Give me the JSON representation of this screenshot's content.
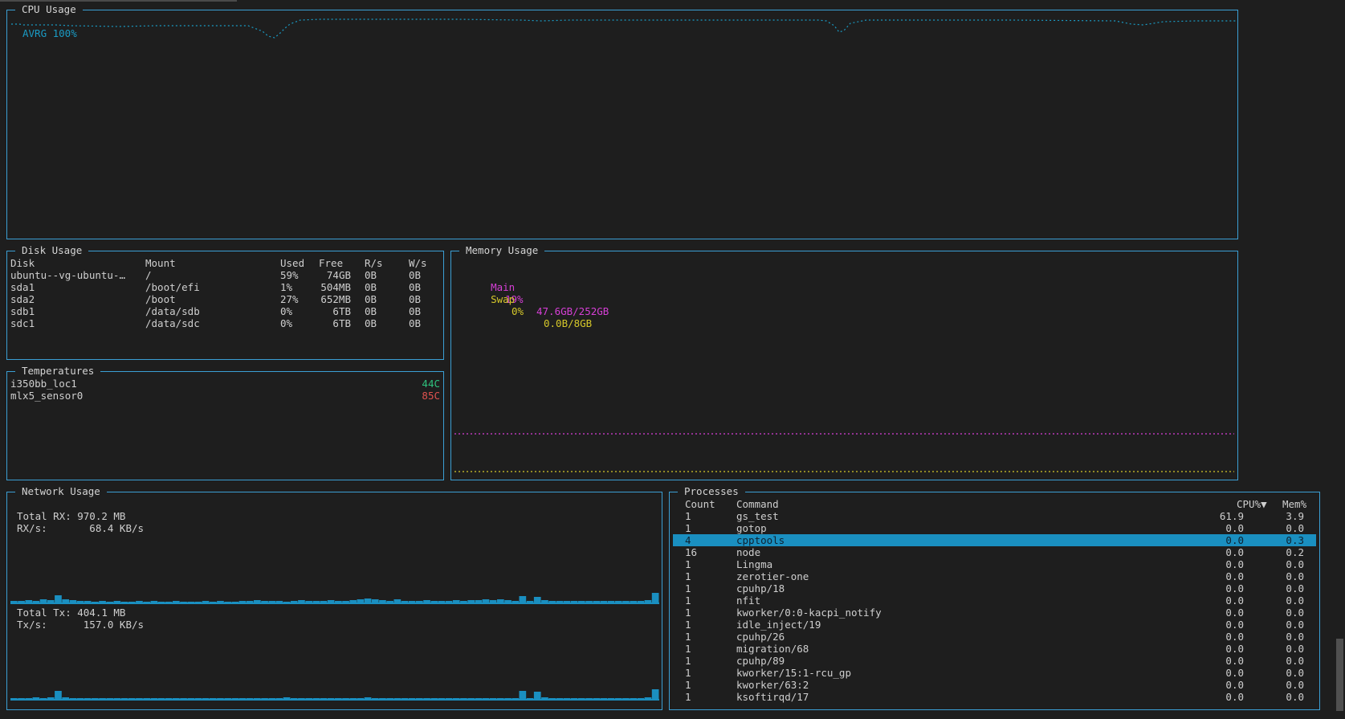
{
  "cpu": {
    "title": "CPU Usage",
    "avg_label": "AVRG 100%",
    "color": "#1a9bc4"
  },
  "disk": {
    "title": "Disk Usage",
    "headers": {
      "disk": "Disk",
      "mount": "Mount",
      "used": "Used",
      "free": "Free",
      "rs": "R/s",
      "ws": "W/s"
    },
    "rows": [
      {
        "disk": "ubuntu--vg-ubuntu-…",
        "mount": "/",
        "used": "59%",
        "free": "74GB",
        "rs": "0B",
        "ws": "0B"
      },
      {
        "disk": "sda1",
        "mount": "/boot/efi",
        "used": "1%",
        "free": "504MB",
        "rs": "0B",
        "ws": "0B"
      },
      {
        "disk": "sda2",
        "mount": "/boot",
        "used": "27%",
        "free": "652MB",
        "rs": "0B",
        "ws": "0B"
      },
      {
        "disk": "sdb1",
        "mount": "/data/sdb",
        "used": "0%",
        "free": "6TB",
        "rs": "0B",
        "ws": "0B"
      },
      {
        "disk": "sdc1",
        "mount": "/data/sdc",
        "used": "0%",
        "free": "6TB",
        "rs": "0B",
        "ws": "0B"
      }
    ]
  },
  "memory": {
    "title": "Memory Usage",
    "main": {
      "label": "Main",
      "percent": "19%",
      "value": "47.6GB/252GB",
      "color": "#d63fd6"
    },
    "swap": {
      "label": "Swap",
      "percent": "0%",
      "value": "0.0B/8GB",
      "color": "#d6c82a"
    }
  },
  "temps": {
    "title": "Temperatures",
    "rows": [
      {
        "name": "i350bb_loc1",
        "value": "44C",
        "color": "#2ec27e"
      },
      {
        "name": "mlx5_sensor0",
        "value": "85C",
        "color": "#e0524f"
      }
    ]
  },
  "network": {
    "title": "Network Usage",
    "rx_total": "Total RX: 970.2 MB",
    "rx_rate": "RX/s:       68.4 KB/s",
    "tx_total": "Total Tx: 404.1 MB",
    "tx_rate": "Tx/s:      157.0 KB/s",
    "bar_color": "#1a8fc0"
  },
  "processes": {
    "title": "Processes",
    "headers": {
      "count": "Count",
      "command": "Command",
      "cpu": "CPU%▼",
      "mem": "Mem%"
    },
    "rows": [
      {
        "count": "1",
        "command": "gs_test",
        "cpu": "61.9",
        "mem": "3.9"
      },
      {
        "count": "1",
        "command": "gotop",
        "cpu": "0.0",
        "mem": "0.0"
      },
      {
        "count": "4",
        "command": "cpptools",
        "cpu": "0.0",
        "mem": "0.3",
        "selected": true
      },
      {
        "count": "16",
        "command": "node",
        "cpu": "0.0",
        "mem": "0.2"
      },
      {
        "count": "1",
        "command": "Lingma",
        "cpu": "0.0",
        "mem": "0.0"
      },
      {
        "count": "1",
        "command": "zerotier-one",
        "cpu": "0.0",
        "mem": "0.0"
      },
      {
        "count": "1",
        "command": "cpuhp/18",
        "cpu": "0.0",
        "mem": "0.0"
      },
      {
        "count": "1",
        "command": "nfit",
        "cpu": "0.0",
        "mem": "0.0"
      },
      {
        "count": "1",
        "command": "kworker/0:0-kacpi_notify",
        "cpu": "0.0",
        "mem": "0.0"
      },
      {
        "count": "1",
        "command": "idle_inject/19",
        "cpu": "0.0",
        "mem": "0.0"
      },
      {
        "count": "1",
        "command": "cpuhp/26",
        "cpu": "0.0",
        "mem": "0.0"
      },
      {
        "count": "1",
        "command": "migration/68",
        "cpu": "0.0",
        "mem": "0.0"
      },
      {
        "count": "1",
        "command": "cpuhp/89",
        "cpu": "0.0",
        "mem": "0.0"
      },
      {
        "count": "1",
        "command": "kworker/15:1-rcu_gp",
        "cpu": "0.0",
        "mem": "0.0"
      },
      {
        "count": "1",
        "command": "kworker/63:2",
        "cpu": "0.0",
        "mem": "0.0"
      },
      {
        "count": "1",
        "command": "ksoftirqd/17",
        "cpu": "0.0",
        "mem": "0.0"
      }
    ]
  }
}
